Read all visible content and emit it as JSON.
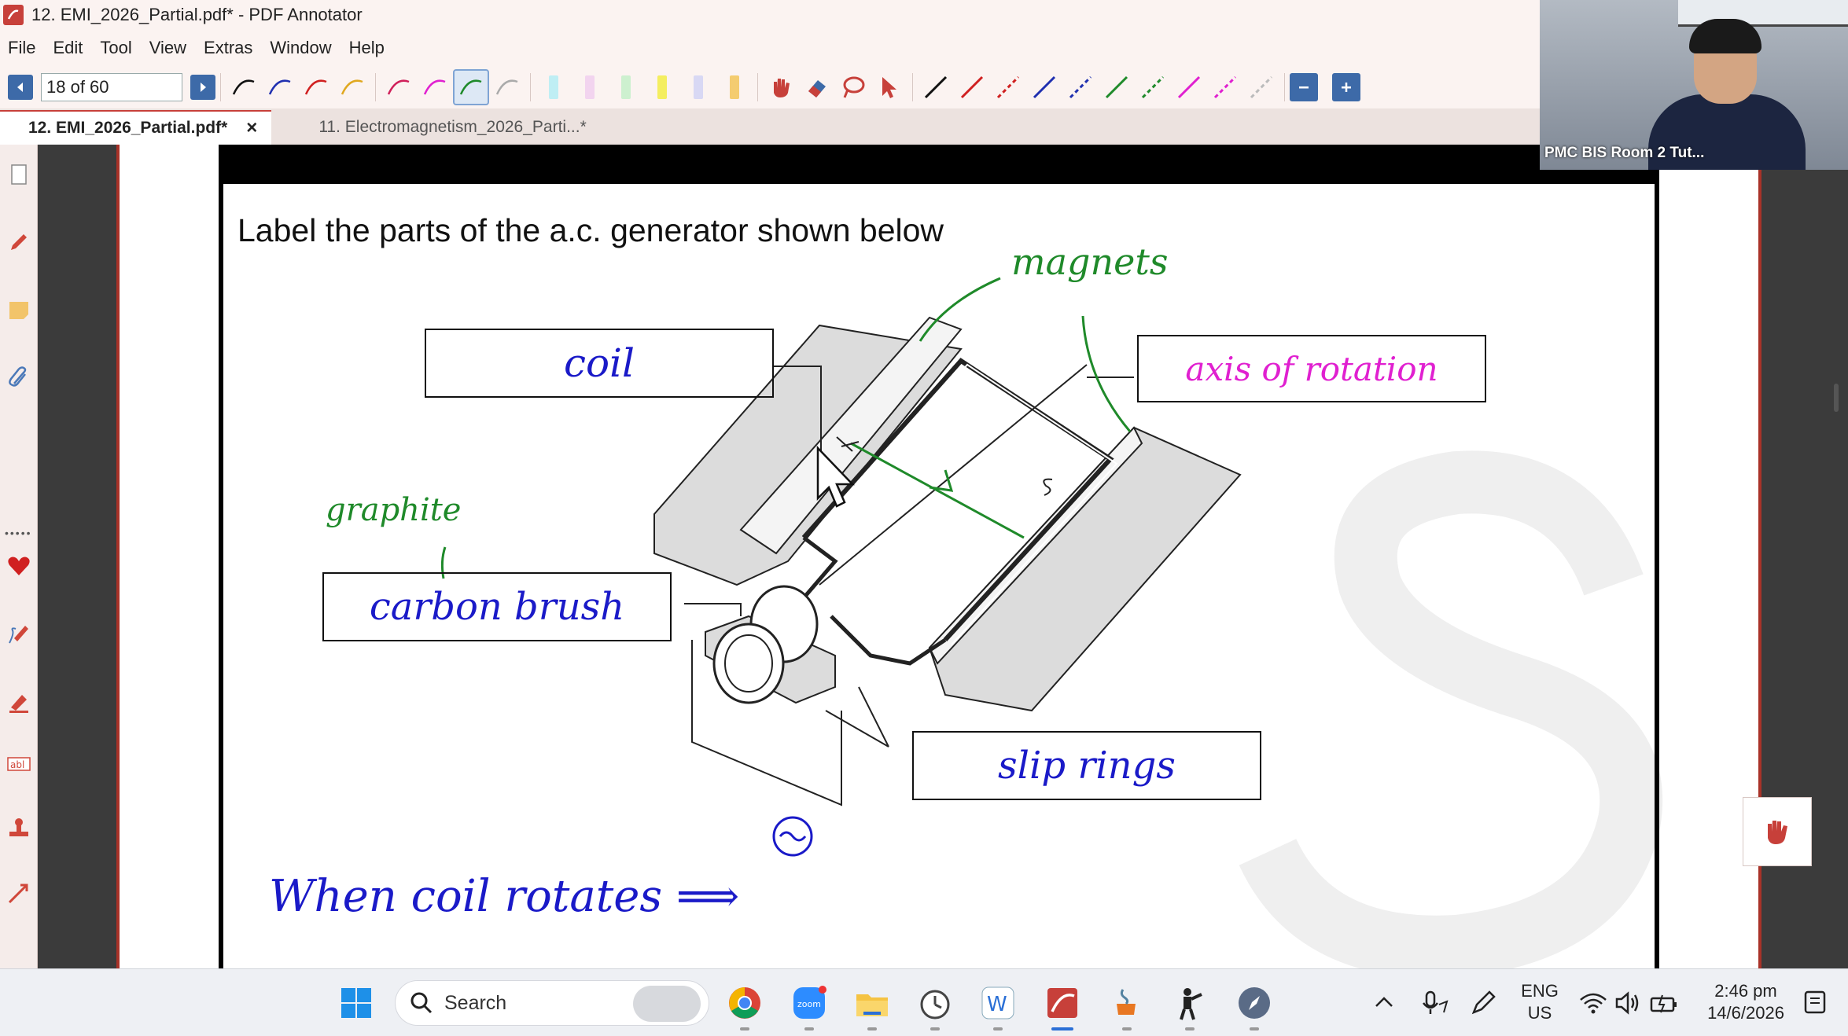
{
  "window": {
    "title": "12. EMI_2026_Partial.pdf* - PDF Annotator"
  },
  "menu": [
    "File",
    "Edit",
    "Tool",
    "View",
    "Extras",
    "Window",
    "Help"
  ],
  "toolbar": {
    "page_indicator": "18 of 60"
  },
  "tabs": [
    {
      "label": "12. EMI_2026_Partial.pdf*",
      "close": "×"
    },
    {
      "label": "11. Electromagnetism_2026_Parti...*"
    }
  ],
  "document": {
    "question": "Label the parts of the a.c. generator shown below",
    "labels": {
      "coil": "coil",
      "axis": "axis of rotation",
      "carbon_brush": "carbon brush",
      "slip_rings": "slip rings"
    },
    "annotations": {
      "magnets": "magnets",
      "graphite": "graphite",
      "when_coil": "When coil rotates ⟹"
    }
  },
  "video": {
    "participant": "PMC BIS Room 2 Tut..."
  },
  "taskbar": {
    "search_placeholder": "Search",
    "language": "ENG",
    "region": "US",
    "time": "2:46 pm",
    "date": "14/6/2026"
  },
  "colors": {
    "accent_red": "#c7403a",
    "ink_blue": "#1a1ac8",
    "ink_green": "#1f8a2a",
    "ink_magenta": "#e020d0"
  }
}
